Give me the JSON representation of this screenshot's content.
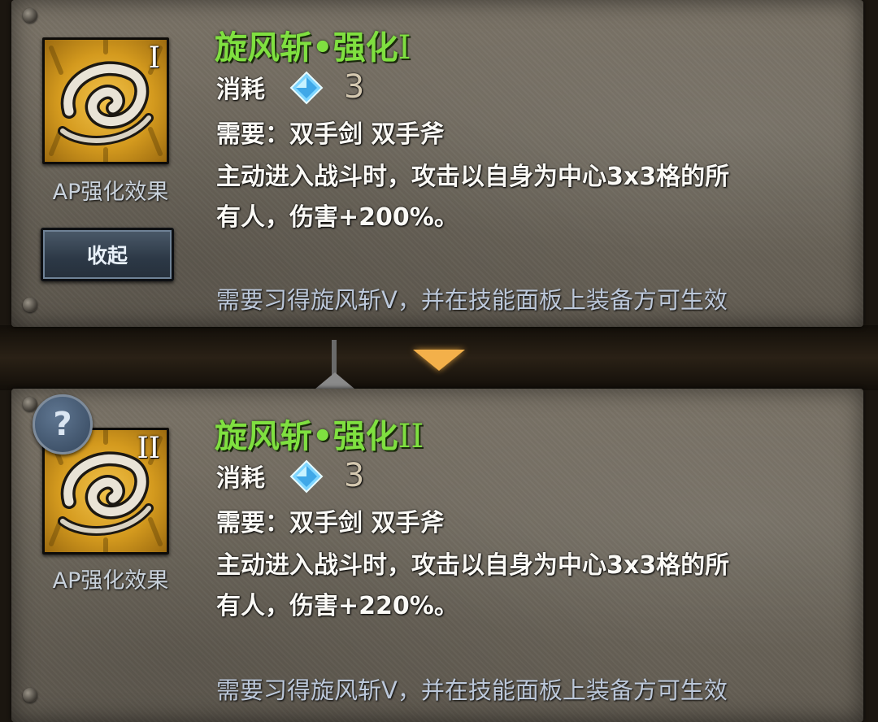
{
  "colors": {
    "title_green": "#7fe040",
    "requirement_blue": "#bcc8da",
    "icon_gold": "#d49a1e",
    "button_blue": "#2c3846",
    "arrow_orange": "#f3b04a"
  },
  "panels": [
    {
      "title": "旋风斩•强化",
      "roman": "I",
      "cost_label": "消耗",
      "cost_value": "3",
      "cost_icon": "diamond-icon",
      "requires": "需要：双手剑  双手斧",
      "desc_line1": "主动进入战斗时，攻击以自身为中心3x3格的所",
      "desc_line2": "有人，伤害+200%。",
      "ap_label": "AP强化效果",
      "collapse_label": "收起",
      "unlock_requirement": "需要习得旋风斩V，并在技能面板上装备方可生效"
    },
    {
      "title": "旋风斩•强化",
      "roman": "II",
      "cost_label": "消耗",
      "cost_value": "3",
      "cost_icon": "diamond-icon",
      "requires": "需要：双手剑  双手斧",
      "desc_line1": "主动进入战斗时，攻击以自身为中心3x3格的所",
      "desc_line2": "有人，伤害+220%。",
      "ap_label": "AP强化效果",
      "help_label": "?",
      "unlock_requirement": "需要习得旋风斩V，并在技能面板上装备方可生效"
    }
  ]
}
